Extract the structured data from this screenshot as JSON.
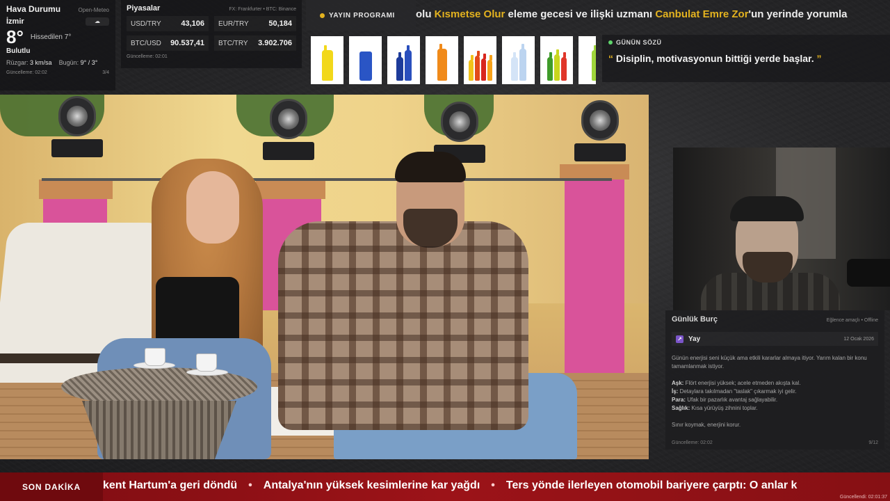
{
  "weather": {
    "title": "Hava Durumu",
    "source": "Open-Meteo",
    "city": "İzmir",
    "temp": "8°",
    "feels_like": "Hissedilen 7°",
    "condition": "Bulutlu",
    "wind_label": "Rüzgar:",
    "wind_value": "3 km/sa",
    "today_label": "Bugün:",
    "today_value": "9° / 3°",
    "updated": "Güncelleme: 02:02",
    "page": "3/4",
    "icon": "cloud-icon"
  },
  "markets": {
    "title": "Piyasalar",
    "source": "FX: Frankfurter • BTC: Binance",
    "rates": [
      {
        "pair": "USD/TRY",
        "value": "43,106"
      },
      {
        "pair": "EUR/TRY",
        "value": "50,184"
      },
      {
        "pair": "BTC/USD",
        "value": "90.537,41"
      },
      {
        "pair": "BTC/TRY",
        "value": "3.902.706"
      }
    ],
    "updated": "Güncelleme: 02:01"
  },
  "schedule": {
    "badge": "YAYIN PROGRAMI",
    "text_pre": "olu ",
    "highlight1": "Kısmetse Olur",
    "text_mid": " eleme gecesi ve ilişki uzmanı ",
    "highlight2": "Canbulat Emre Zor",
    "text_post": "'un yerinde yorumla"
  },
  "quote": {
    "label": "GÜNÜN SÖZÜ",
    "open_mark": "“",
    "text": "Disiplin, motivasyonun bittiği yerde başlar.",
    "close_mark": "”"
  },
  "horoscope": {
    "title": "Günlük Burç",
    "source": "Eğlence amaçlı • Offline",
    "sign": "Yay",
    "sign_icon": "sagittarius-icon",
    "date": "12 Ocak 2026",
    "intro": "Günün enerjisi seni küçük ama etkili kararlar almaya itiyor. Yarım kalan bir konu tamamlanmak istiyor.",
    "items": [
      {
        "label": "Aşk:",
        "text": " Flört enerjisi yüksek; acele etmeden akışta kal."
      },
      {
        "label": "İş:",
        "text": " Detaylara takılmadan \"taslak\" çıkarmak iyi gelir."
      },
      {
        "label": "Para:",
        "text": " Ufak bir pazarlık avantaj sağlayabilir."
      },
      {
        "label": "Sağlık:",
        "text": " Kısa yürüyüş zihnini toplar."
      }
    ],
    "closing": "Sınır koymak, enerjini korur.",
    "updated": "Güncelleme: 02:02",
    "page": "9/12"
  },
  "breaking": {
    "label": "SON DAKİKA",
    "items": [
      "kent Hartum'a geri döndü",
      "Antalya'nın yüksek kesimlerine kar yağdı",
      "Ters yönde ilerleyen otomobil bariyere çarptı: O anlar k"
    ],
    "separator": "•",
    "updated": "Güncellendi: 02:01:37"
  },
  "colors": {
    "accent": "#e3b21f",
    "breaking": "#9c1318",
    "live_dot": "#5fd46b"
  }
}
